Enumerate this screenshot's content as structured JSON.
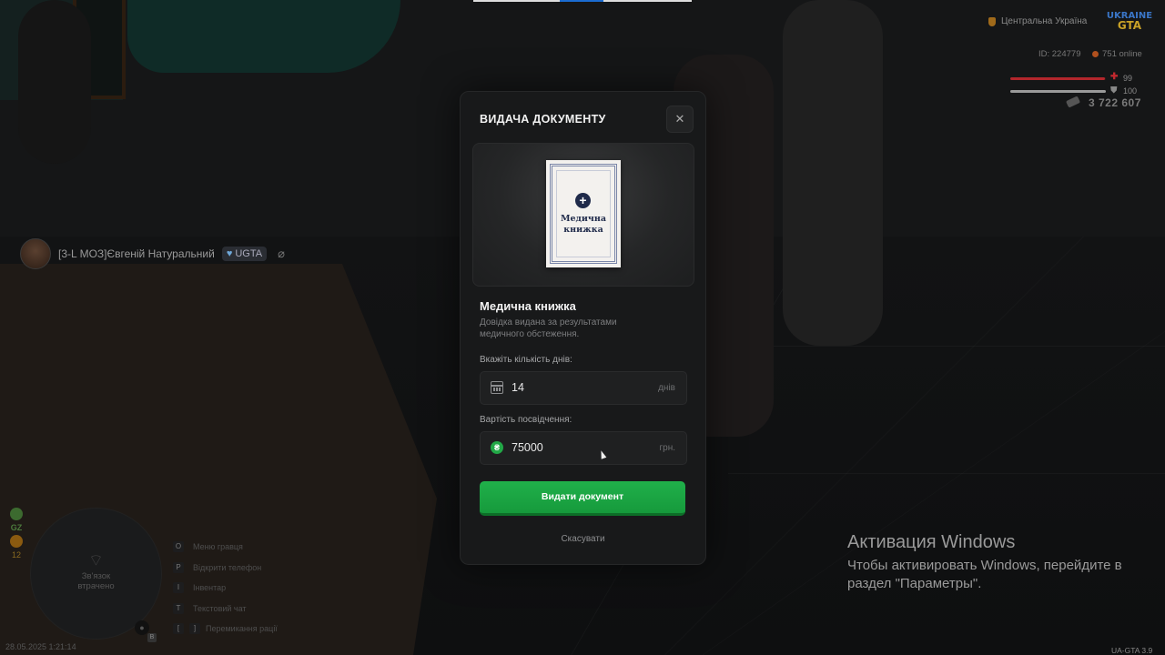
{
  "hud": {
    "region": "Центральна Україна",
    "logo_line1": "UKRAINE",
    "logo_line2": "GTA",
    "player_id": "ID: 224779",
    "online": "751 online",
    "health": "99",
    "armor": "100",
    "money": "3 722 607",
    "health_level": 99,
    "armor_level": 100,
    "colors": {
      "health": "#b3262c",
      "armor": "#9a9a9a"
    }
  },
  "nametag": {
    "name": "[3-L МОЗ]Євгеній Натуральний",
    "badge": "UGTA"
  },
  "left_hud": {
    "gz_label": "GZ",
    "count": "12",
    "minimap_text": "Зв'язок втрачено",
    "datetime": "28.05.2025 1:21:14",
    "mic_key": "B"
  },
  "keybinds": [
    {
      "key": "O",
      "label": "Меню гравця"
    },
    {
      "key": "P",
      "label": "Відкрити телефон"
    },
    {
      "key": "I",
      "label": "Інвентар"
    },
    {
      "key": "T",
      "label": "Текстовий чат"
    },
    {
      "key": "[",
      "key2": "]",
      "label": "Перемикання рації"
    }
  ],
  "modal": {
    "title": "ВИДАЧА ДОКУМЕНТУ",
    "close": "✕",
    "doc_card_title": "Медична книжка",
    "doc_name": "Медична книжка",
    "doc_desc": "Довідка видана за результатами медичного обстеження.",
    "days_label": "Вкажіть кількість днів:",
    "days_value": "14",
    "days_suffix": "днів",
    "price_label": "Вартість посвідчення:",
    "price_value": "75000",
    "price_suffix": "грн.",
    "currency_symbol": "₴",
    "submit": "Видати документ",
    "cancel": "Скасувати",
    "colors": {
      "primary": "#1fae48",
      "surface": "#18191a"
    }
  },
  "windows_activation": {
    "title": "Активация Windows",
    "text": "Чтобы активировать Windows, перейдите в раздел \"Параметры\"."
  },
  "version": "UA-GTA 3.9"
}
